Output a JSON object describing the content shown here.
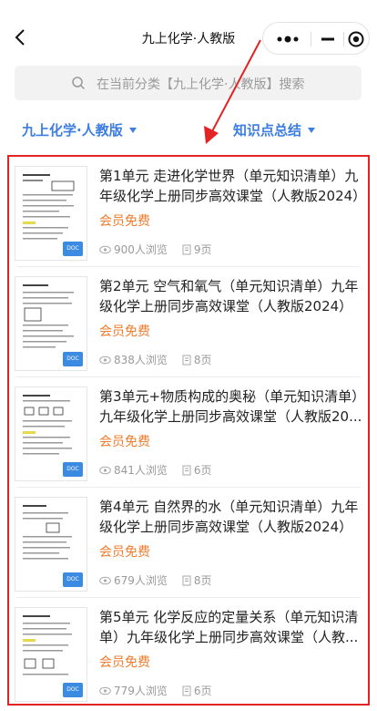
{
  "nav": {
    "title": "九上化学·人教版"
  },
  "search": {
    "placeholder": "在当前分类【九上化学·人教版】搜索"
  },
  "filters": {
    "left": "九上化学·人教版",
    "right": "知识点总结"
  },
  "items": [
    {
      "title": "第1单元 走进化学世界（单元知识清单）九年级化学上册同步高效课堂（人教版2024）",
      "price": "会员免费",
      "views": "900人浏览",
      "pages": "9页",
      "badge": "DOC"
    },
    {
      "title": "第2单元 空气和氧气（单元知识清单）九年级化学上册同步高效课堂（人教版2024）",
      "price": "会员免费",
      "views": "838人浏览",
      "pages": "8页",
      "badge": "DOC"
    },
    {
      "title": "第3单元+物质构成的奥秘（单元知识清单）九年级化学上册同步高效课堂（人教版20...",
      "price": "会员免费",
      "views": "841人浏览",
      "pages": "6页",
      "badge": "DOC"
    },
    {
      "title": "第4单元 自然界的水（单元知识清单）九年级化学上册同步高效课堂（人教版2024）",
      "price": "会员免费",
      "views": "679人浏览",
      "pages": "8页",
      "badge": "DOC"
    },
    {
      "title": "第5单元 化学反应的定量关系（单元知识清单）九年级化学上册同步高效课堂（人教...",
      "price": "会员免费",
      "views": "779人浏览",
      "pages": "6页",
      "badge": "DOC"
    }
  ],
  "colors": {
    "accent": "#3d7ee0",
    "price": "#f07c2d",
    "highlight": "#e32424"
  }
}
